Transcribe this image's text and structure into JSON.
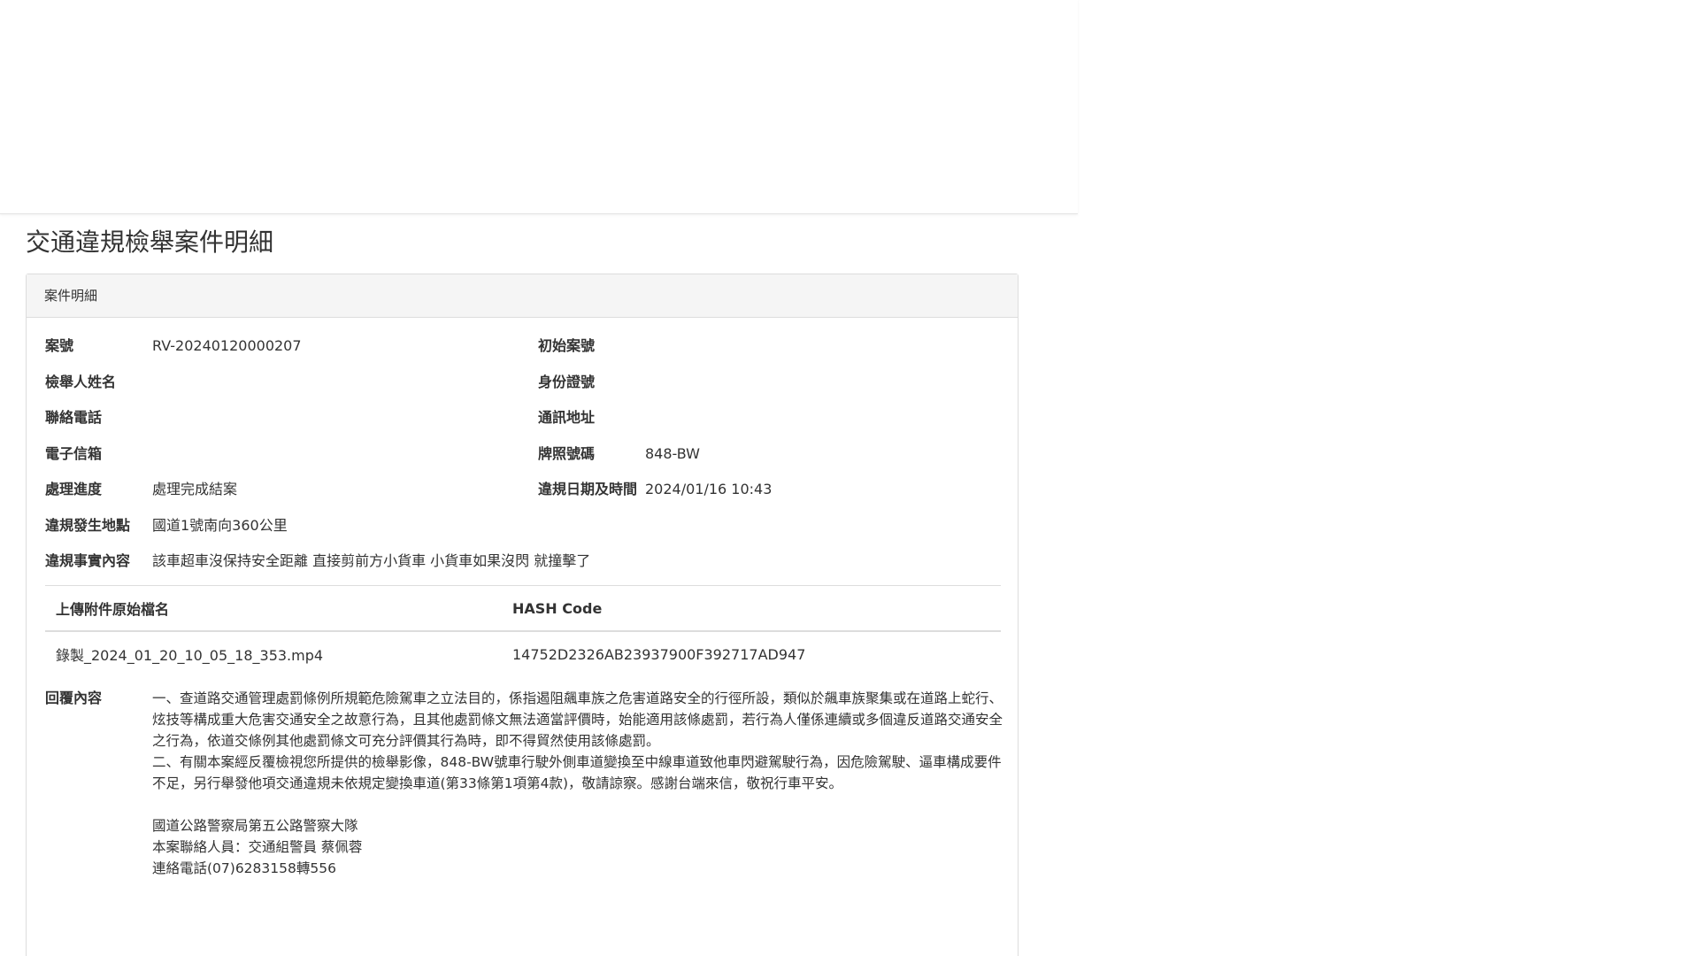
{
  "page_title": "交通違規檢舉案件明細",
  "panel_heading": "案件明細",
  "fields": {
    "case_no": {
      "label": "案號",
      "value": "RV-20240120000207"
    },
    "initial_case_no": {
      "label": "初始案號",
      "value": ""
    },
    "reporter_name": {
      "label": "檢舉人姓名",
      "value": ""
    },
    "id_no": {
      "label": "身份證號",
      "value": ""
    },
    "phone": {
      "label": "聯絡電話",
      "value": ""
    },
    "address": {
      "label": "通訊地址",
      "value": ""
    },
    "email": {
      "label": "電子信箱",
      "value": ""
    },
    "plate_no": {
      "label": "牌照號碼",
      "value": "848-BW"
    },
    "progress": {
      "label": "處理進度",
      "value": "處理完成結案"
    },
    "violation_datetime": {
      "label": "違規日期及時間",
      "value": "2024/01/16 10:43"
    },
    "location": {
      "label": "違規發生地點",
      "value": "國道1號南向360公里"
    },
    "facts": {
      "label": "違規事實內容",
      "value": "該車超車沒保持安全距離 直接剪前方小貨車 小貨車如果沒閃 就撞擊了"
    }
  },
  "attachments": {
    "headers": [
      "上傳附件原始檔名",
      "HASH Code"
    ],
    "rows": [
      {
        "filename": "錄製_2024_01_20_10_05_18_353.mp4",
        "hash": "14752D2326AB23937900F392717AD947"
      }
    ]
  },
  "reply": {
    "label": "回覆內容",
    "paragraphs": [
      "一、查道路交通管理處罰條例所規範危險駕車之立法目的，係指遏阻飆車族之危害道路安全的行徑所設，類似於飆車族聚集或在道路上蛇行、炫技等構成重大危害交通安全之故意行為，且其他處罰條文無法適當評價時，始能適用該條處罰，若行為人僅係連續或多個違反道路交通安全之行為，依道交條例其他處罰條文可充分評價其行為時，即不得貿然使用該條處罰。",
      "二、有關本案經反覆檢視您所提供的檢舉影像，848-BW號車行駛外側車道變換至中線車道致他車閃避駕駛行為，因危險駕駛、逼車構成要件不足，另行舉發他項交通違規未依規定變換車道(第33條第1項第4款)，敬請諒察。感謝台端來信，敬祝行車平安。"
    ],
    "signature": [
      "國道公路警察局第五公路警察大隊",
      "本案聯絡人員：交通組警員 蔡佩蓉",
      "連絡電話(07)6283158轉556"
    ]
  }
}
